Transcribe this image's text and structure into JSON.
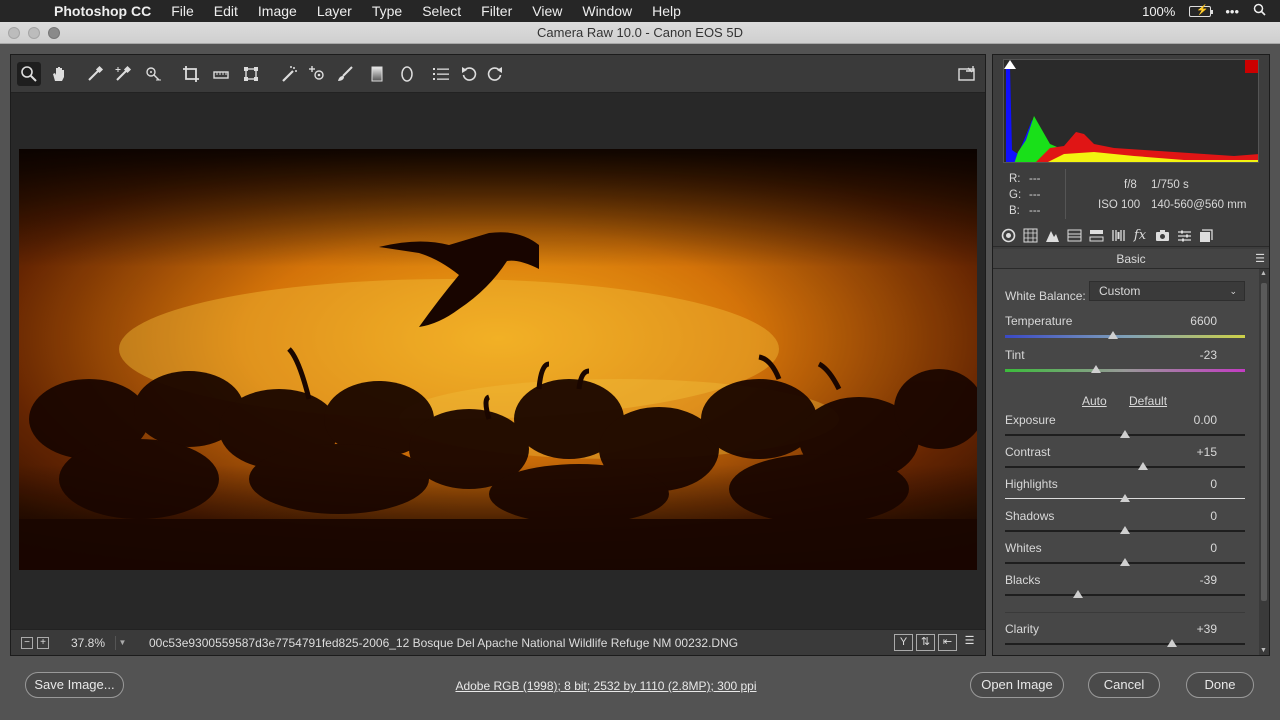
{
  "menubar": {
    "app": "Photoshop CC",
    "items": [
      "File",
      "Edit",
      "Image",
      "Layer",
      "Type",
      "Select",
      "Filter",
      "View",
      "Window",
      "Help"
    ],
    "battery": "100%"
  },
  "window": {
    "title": "Camera Raw 10.0  -  Canon EOS 5D"
  },
  "status": {
    "zoom": "37.8%",
    "filename": "00c53e9300559587d3e7754791fed825-2006_12 Bosque Del Apache National Wildlife Refuge NM 00232.DNG",
    "view_btn_1": "Y"
  },
  "camera_info": {
    "r_label": "R:",
    "g_label": "G:",
    "b_label": "B:",
    "r": "---",
    "g": "---",
    "b": "---",
    "aperture": "f/8",
    "shutter": "1/750 s",
    "iso": "ISO 100",
    "lens": "140-560@560 mm"
  },
  "panel": {
    "title": "Basic",
    "white_balance_label": "White Balance:",
    "white_balance_value": "Custom",
    "auto": "Auto",
    "default": "Default",
    "sliders": [
      {
        "label": "Temperature",
        "value": "6600",
        "position": 0.45
      },
      {
        "label": "Tint",
        "value": "-23",
        "position": 0.38
      },
      {
        "label": "Exposure",
        "value": "0.00",
        "position": 0.5
      },
      {
        "label": "Contrast",
        "value": "+15",
        "position": 0.575
      },
      {
        "label": "Highlights",
        "value": "0",
        "position": 0.5
      },
      {
        "label": "Shadows",
        "value": "0",
        "position": 0.5
      },
      {
        "label": "Whites",
        "value": "0",
        "position": 0.5
      },
      {
        "label": "Blacks",
        "value": "-39",
        "position": 0.305
      },
      {
        "label": "Clarity",
        "value": "+39",
        "position": 0.695
      }
    ]
  },
  "buttons": {
    "save": "Save Image...",
    "open": "Open Image",
    "cancel": "Cancel",
    "done": "Done"
  },
  "workflow": "Adobe RGB (1998); 8 bit; 2532 by 1110 (2.8MP); 300 ppi"
}
